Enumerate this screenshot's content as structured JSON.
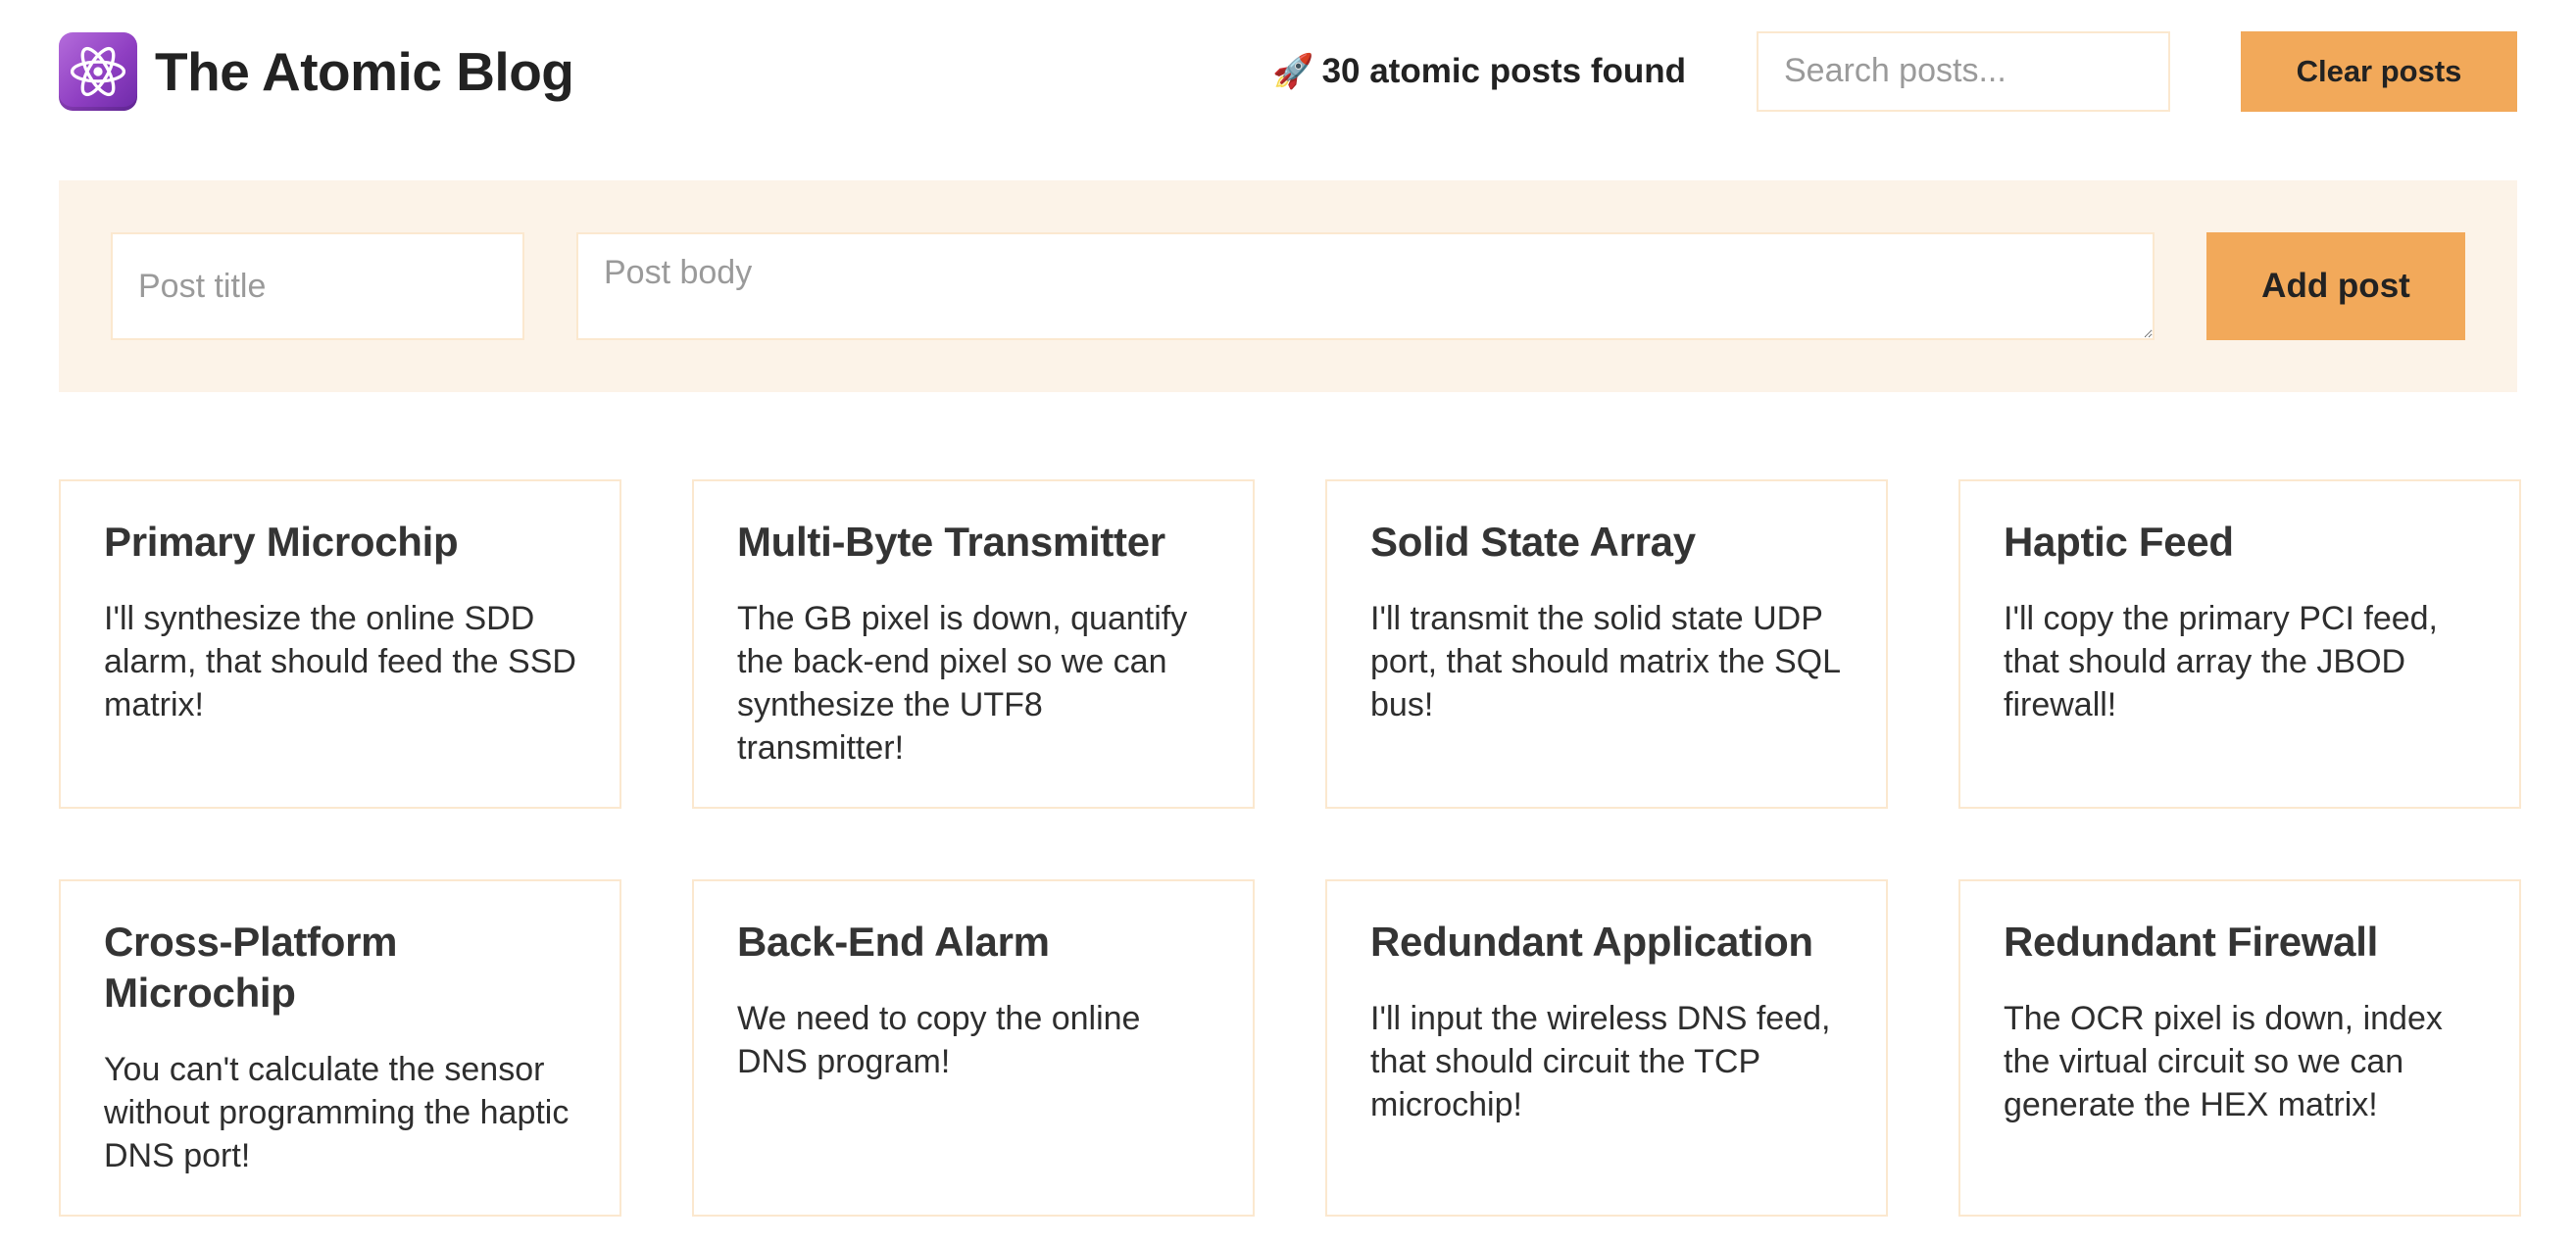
{
  "header": {
    "logo_icon": "atom-icon",
    "title": "The Atomic Blog",
    "post_count_emoji": "🚀",
    "post_count_text": "30 atomic posts found",
    "search_placeholder": "Search posts...",
    "clear_button_label": "Clear posts"
  },
  "form": {
    "title_placeholder": "Post title",
    "body_placeholder": "Post body",
    "add_button_label": "Add post"
  },
  "posts": [
    {
      "title": "Primary Microchip",
      "body": "I'll synthesize the online SDD alarm, that should feed the SSD matrix!"
    },
    {
      "title": "Multi-Byte Transmitter",
      "body": "The GB pixel is down, quantify the back-end pixel so we can synthesize the UTF8 transmitter!"
    },
    {
      "title": "Solid State Array",
      "body": "I'll transmit the solid state UDP port, that should matrix the SQL bus!"
    },
    {
      "title": "Haptic Feed",
      "body": "I'll copy the primary PCI feed, that should array the JBOD firewall!"
    },
    {
      "title": "Cross-Platform Microchip",
      "body": "You can't calculate the sensor without programming the haptic DNS port!"
    },
    {
      "title": "Back-End Alarm",
      "body": "We need to copy the online DNS program!"
    },
    {
      "title": "Redundant Application",
      "body": "I'll input the wireless DNS feed, that should circuit the TCP microchip!"
    },
    {
      "title": "Redundant Firewall",
      "body": "The OCR pixel is down, index the virtual circuit so we can generate the HEX matrix!"
    }
  ],
  "colors": {
    "accent": "#f2a95a",
    "form_background": "#fcf3e8",
    "border": "#fbe8cf",
    "logo": "#9b4fcf"
  }
}
